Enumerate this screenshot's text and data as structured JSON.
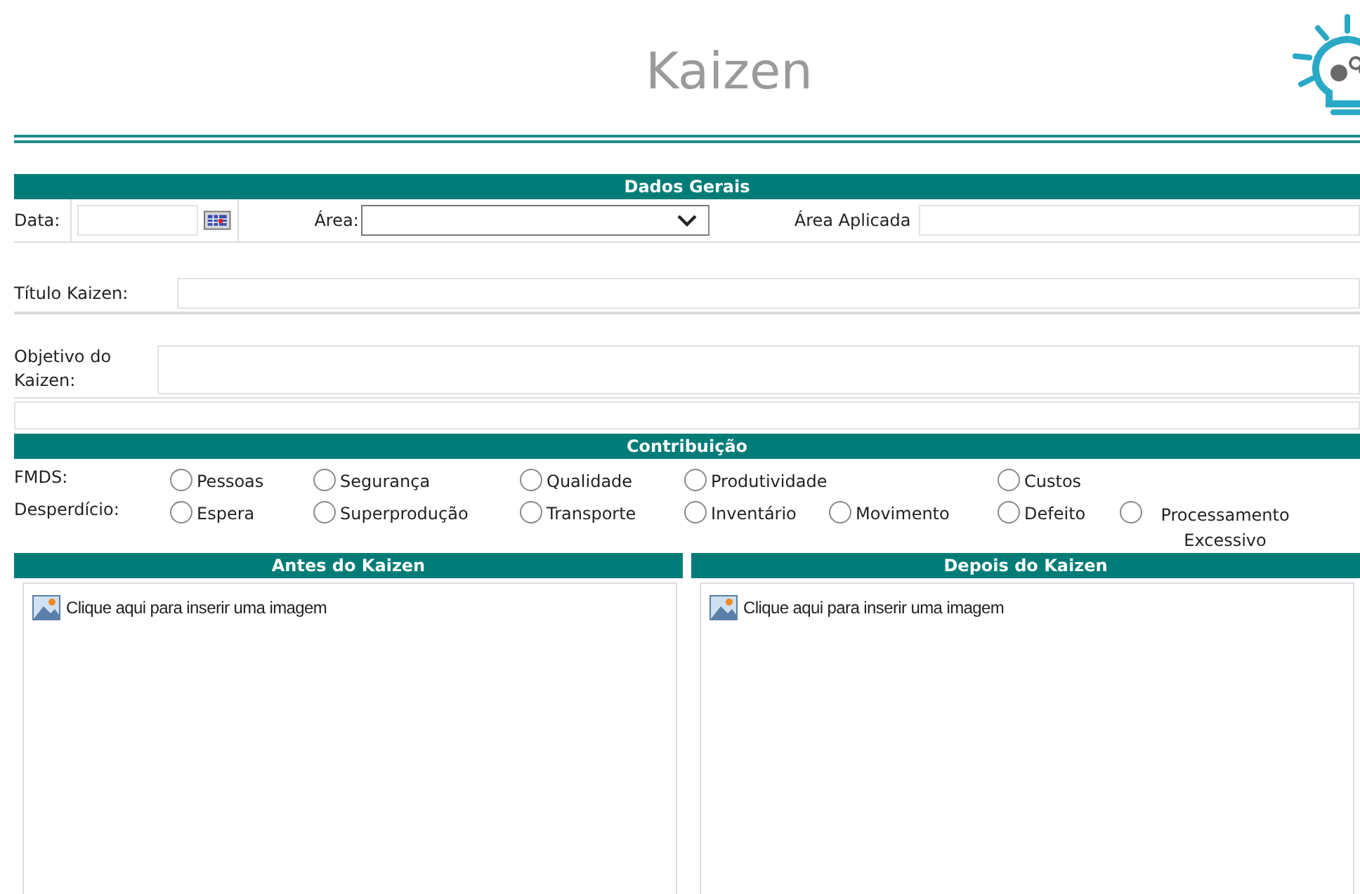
{
  "header": {
    "title": "Kaizen"
  },
  "dados_gerais": {
    "heading": "Dados Gerais",
    "date_label": "Data:",
    "area_label": "Área:",
    "area_aplicada_label": "Área Aplicada",
    "titulo_label": "Título Kaizen:",
    "objetivo_label": "Objetivo do Kaizen:"
  },
  "contribuicao": {
    "heading": "Contribuição",
    "groups": [
      {
        "label": "FMDS:",
        "options": [
          {
            "label": "Pessoas",
            "selected": false
          },
          {
            "label": "Segurança",
            "selected": false
          },
          {
            "label": "Qualidade",
            "selected": false
          },
          {
            "label": "Produtividade",
            "selected": false
          },
          {
            "label": "Custos",
            "selected": false
          }
        ]
      },
      {
        "label": "Desperdício:",
        "options": [
          {
            "label": "Espera",
            "selected": false
          },
          {
            "label": "Superprodução",
            "selected": false
          },
          {
            "label": "Transporte",
            "selected": false
          },
          {
            "label": "Inventário",
            "selected": false
          },
          {
            "label": "Movimento",
            "selected": false
          },
          {
            "label": "Defeito",
            "selected": false
          },
          {
            "label": "Processamento Excessivo",
            "selected": false
          }
        ]
      }
    ]
  },
  "panels": [
    {
      "heading": "Antes do Kaizen",
      "placeholder": "Clique aqui para inserir uma imagem"
    },
    {
      "heading": "Depois do Kaizen",
      "placeholder": "Clique aqui para inserir uma imagem"
    }
  ]
}
